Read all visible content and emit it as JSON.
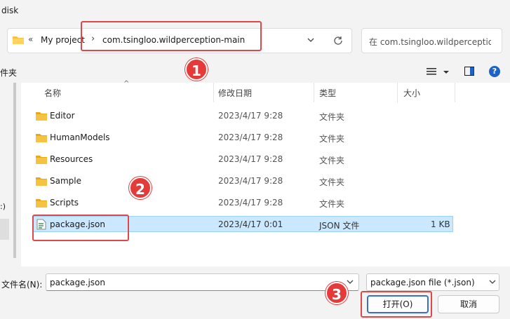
{
  "window": {
    "title": "disk"
  },
  "address_bar": {
    "chevrons": "«",
    "crumbs": [
      "My project",
      "com.tsingloo.wildperception-main"
    ],
    "separator": "›"
  },
  "search": {
    "placeholder": "在 com.tsingloo.wildperception-main 中搜索"
  },
  "toolbar": {
    "left_label": "件夹"
  },
  "nav_pane": {
    "partial_item": ":)"
  },
  "columns": [
    "名称",
    "修改日期",
    "类型",
    "大小"
  ],
  "files": [
    {
      "name": "Editor",
      "date": "2023/4/17 9:28",
      "type": "文件夹",
      "size": "",
      "kind": "folder"
    },
    {
      "name": "HumanModels",
      "date": "2023/4/17 9:28",
      "type": "文件夹",
      "size": "",
      "kind": "folder"
    },
    {
      "name": "Resources",
      "date": "2023/4/17 9:28",
      "type": "文件夹",
      "size": "",
      "kind": "folder"
    },
    {
      "name": "Sample",
      "date": "2023/4/17 9:28",
      "type": "文件夹",
      "size": "",
      "kind": "folder"
    },
    {
      "name": "Scripts",
      "date": "2023/4/17 9:28",
      "type": "文件夹",
      "size": "",
      "kind": "folder"
    },
    {
      "name": "package.json",
      "date": "2023/4/17 0:01",
      "type": "JSON 文件",
      "size": "1 KB",
      "kind": "json"
    }
  ],
  "filename": {
    "label": "文件名(N):",
    "value": "package.json"
  },
  "filter": {
    "value": "package.json file (*.json)"
  },
  "buttons": {
    "open": "打开(O)",
    "cancel": "取消"
  },
  "annotations": [
    "1",
    "2",
    "3"
  ],
  "colors": {
    "selection": "#cce8ff",
    "annotation": "#e43a3a",
    "folder": "#f5c242",
    "accent": "#1d63c5"
  }
}
